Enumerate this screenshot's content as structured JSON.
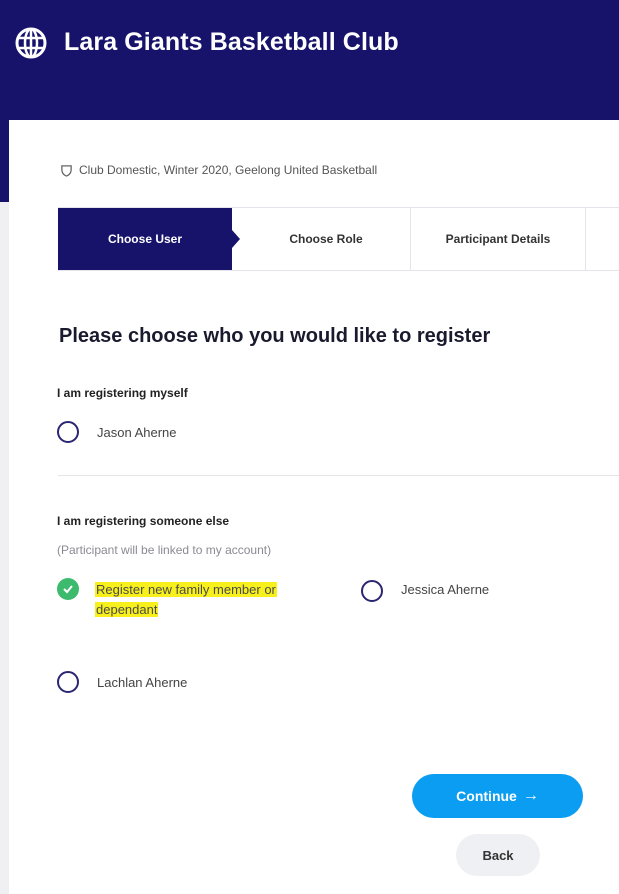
{
  "header": {
    "club_name": "Lara Giants Basketball Club",
    "logo_icon": "globe-icon"
  },
  "competition": {
    "icon": "shield-icon",
    "text": "Club Domestic, Winter 2020, Geelong United Basketball"
  },
  "steps": [
    {
      "label": "Choose User",
      "active": true
    },
    {
      "label": "Choose Role",
      "active": false
    },
    {
      "label": "Participant Details",
      "active": false
    }
  ],
  "question": "Please choose who you would like to register",
  "self_section": {
    "label": "I am registering myself",
    "options": [
      {
        "label": "Jason Aherne",
        "checked": false
      }
    ]
  },
  "other_section": {
    "label": "I am registering someone else",
    "hint": "(Participant will be linked to my account)",
    "options": [
      {
        "label_line1": "Register new family member or",
        "label_line2": "dependant",
        "checked": true,
        "highlighted": true
      },
      {
        "label": "Jessica Aherne",
        "checked": false
      },
      {
        "label": "Lachlan Aherne",
        "checked": false
      }
    ]
  },
  "actions": {
    "continue_label": "Continue",
    "continue_icon": "arrow-right-icon",
    "back_label": "Back"
  },
  "colors": {
    "brand_navy": "#17136b",
    "accent_blue": "#0a9df2",
    "check_green": "#3cba6e",
    "highlight_yellow": "#f7f01c"
  }
}
